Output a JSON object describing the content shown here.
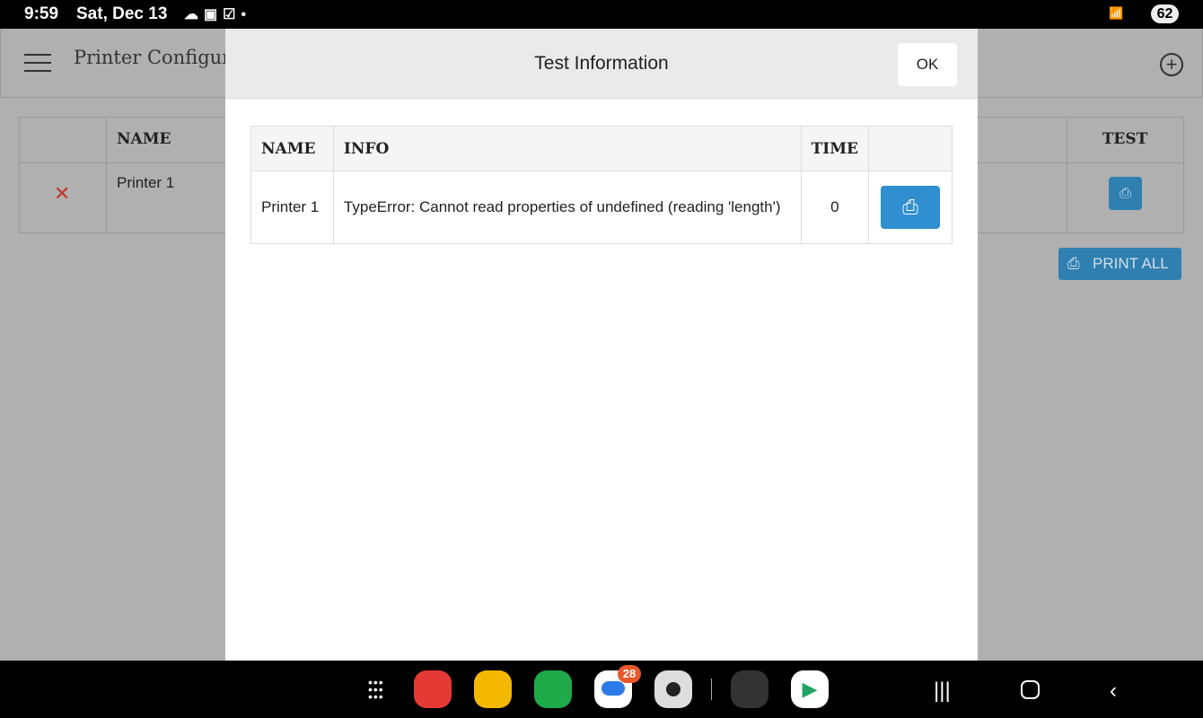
{
  "status": {
    "time": "9:59",
    "date": "Sat, Dec 13",
    "battery": "62"
  },
  "appbar": {
    "title": "Printer Configura"
  },
  "background_table": {
    "headers": [
      "NAME",
      "TEST"
    ],
    "rows": [
      {
        "name": "Printer 1"
      }
    ],
    "print_all": "PRINT ALL"
  },
  "modal": {
    "title": "Test Information",
    "ok": "OK",
    "headers": [
      "NAME",
      "INFO",
      "TIME",
      ""
    ],
    "rows": [
      {
        "name": "Printer 1",
        "info": "TypeError: Cannot read properties of undefined (reading 'length')",
        "time": "0"
      }
    ]
  },
  "dock": {
    "messages_badge": "28"
  },
  "colors": {
    "accent": "#2f8fd0",
    "delete": "#c0392b"
  }
}
